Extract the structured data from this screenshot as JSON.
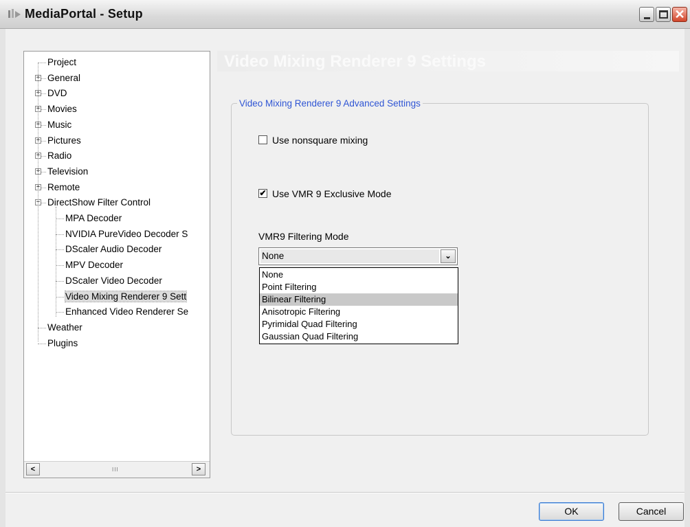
{
  "window": {
    "title": "MediaPortal - Setup",
    "controls": {
      "minimize": "_",
      "maximize": "□",
      "close": "✕"
    }
  },
  "tree": {
    "nodes": [
      {
        "label": "Project",
        "expandable": false
      },
      {
        "label": "General",
        "expandable": true,
        "expander": "+"
      },
      {
        "label": "DVD",
        "expandable": true,
        "expander": "+"
      },
      {
        "label": "Movies",
        "expandable": true,
        "expander": "+"
      },
      {
        "label": "Music",
        "expandable": true,
        "expander": "+"
      },
      {
        "label": "Pictures",
        "expandable": true,
        "expander": "+"
      },
      {
        "label": "Radio",
        "expandable": true,
        "expander": "+"
      },
      {
        "label": "Television",
        "expandable": true,
        "expander": "+"
      },
      {
        "label": "Remote",
        "expandable": true,
        "expander": "+"
      },
      {
        "label": "DirectShow Filter Control",
        "expandable": true,
        "expander": "−"
      },
      {
        "label": "MPA Decoder"
      },
      {
        "label": "NVIDIA PureVideo Decoder S"
      },
      {
        "label": "DScaler Audio Decoder"
      },
      {
        "label": "MPV Decoder"
      },
      {
        "label": "DScaler Video Decoder"
      },
      {
        "label": "Video Mixing Renderer 9 Sett",
        "selected": true
      },
      {
        "label": "Enhanced Video Renderer Se"
      },
      {
        "label": "Weather"
      },
      {
        "label": "Plugins"
      }
    ],
    "scroll": {
      "left": "<",
      "right": ">",
      "grip": "III"
    }
  },
  "section_header": "Video Mixing Renderer 9 Settings",
  "groupbox_title": "Video Mixing Renderer 9 Advanced Settings",
  "nonsquare": {
    "label": "Use nonsquare mixing",
    "checked": false,
    "mark": ""
  },
  "exclusive": {
    "label": "Use VMR 9 Exclusive Mode",
    "checked": true,
    "mark": "✔"
  },
  "filtering": {
    "label": "VMR9 Filtering Mode",
    "selected": "None",
    "arrow": "⌄",
    "options": [
      "None",
      "Point Filtering",
      "Bilinear Filtering",
      "Anisotropic Filtering",
      "Pyrimidal Quad Filtering",
      "Gaussian Quad Filtering"
    ],
    "highlighted_option": "Bilinear Filtering"
  },
  "buttons": {
    "ok": "OK",
    "cancel": "Cancel"
  },
  "colors": {
    "legend": "#2f55d4",
    "highlight": "#c9c9c9",
    "close_button": "#d2462a"
  }
}
